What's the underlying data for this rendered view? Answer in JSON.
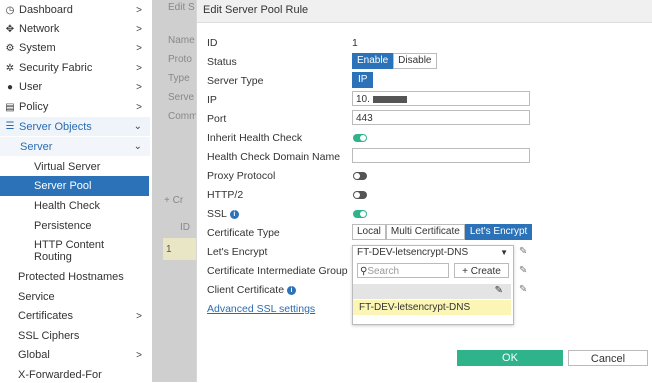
{
  "sidebar": {
    "items": [
      {
        "label": "Dashboard",
        "icon": "dashboard-icon",
        "glyph": "◷",
        "chevron": true
      },
      {
        "label": "Network",
        "icon": "network-icon",
        "glyph": "✥",
        "chevron": true
      },
      {
        "label": "System",
        "icon": "gear-icon",
        "glyph": "⚙",
        "chevron": true
      },
      {
        "label": "Security Fabric",
        "icon": "security-fabric-icon",
        "glyph": "✲",
        "chevron": true
      },
      {
        "label": "User",
        "icon": "user-icon",
        "glyph": "●",
        "chevron": true
      },
      {
        "label": "Policy",
        "icon": "policy-icon",
        "glyph": "▤",
        "chevron": true
      },
      {
        "label": "Server Objects",
        "icon": "server-objects-icon",
        "glyph": "☰",
        "chevron": "down"
      }
    ],
    "server": {
      "label": "Server"
    },
    "subitems": [
      "Virtual Server",
      "Server Pool",
      "Health Check",
      "Persistence",
      "HTTP Content Routing"
    ],
    "after": [
      "Protected Hostnames",
      "Service",
      "Certificates",
      "SSL Ciphers",
      "Global",
      "X-Forwarded-For"
    ]
  },
  "background": {
    "header": "Edit S",
    "stubs": [
      "Name",
      "Proto",
      "Type",
      "Serve",
      "Comm"
    ],
    "add": "+ Cr",
    "col_id": "ID",
    "row_id": "1"
  },
  "modal": {
    "title": "Edit Server Pool Rule",
    "id_label": "ID",
    "id_value": "1",
    "status_label": "Status",
    "status_enable": "Enable",
    "status_disable": "Disable",
    "server_type_label": "Server Type",
    "server_type_value": "IP",
    "ip_label": "IP",
    "ip_value": "10.",
    "port_label": "Port",
    "port_value": "443",
    "inherit_label": "Inherit Health Check",
    "hc_domain_label": "Health Check Domain Name",
    "proxy_label": "Proxy Protocol",
    "http2_label": "HTTP/2",
    "ssl_label": "SSL",
    "cert_type_label": "Certificate Type",
    "cert_type_options": [
      "Local",
      "Multi Certificate",
      "Let's Encrypt"
    ],
    "letsencrypt_label": "Let's Encrypt",
    "letsencrypt_value": "FT-DEV-letsencrypt-DNS",
    "intermediate_label": "Certificate Intermediate Group",
    "client_cert_label": "Client Certificate",
    "advanced_link": "Advanced SSL settings",
    "dropdown": {
      "search_placeholder": "Search",
      "create": "+ Create",
      "option": "FT-DEV-letsencrypt-DNS"
    },
    "ok": "OK",
    "cancel": "Cancel"
  },
  "colors": {
    "accent": "#2b72b8",
    "toggle_on": "#2fb38a",
    "ok_button": "#2fb38a"
  }
}
